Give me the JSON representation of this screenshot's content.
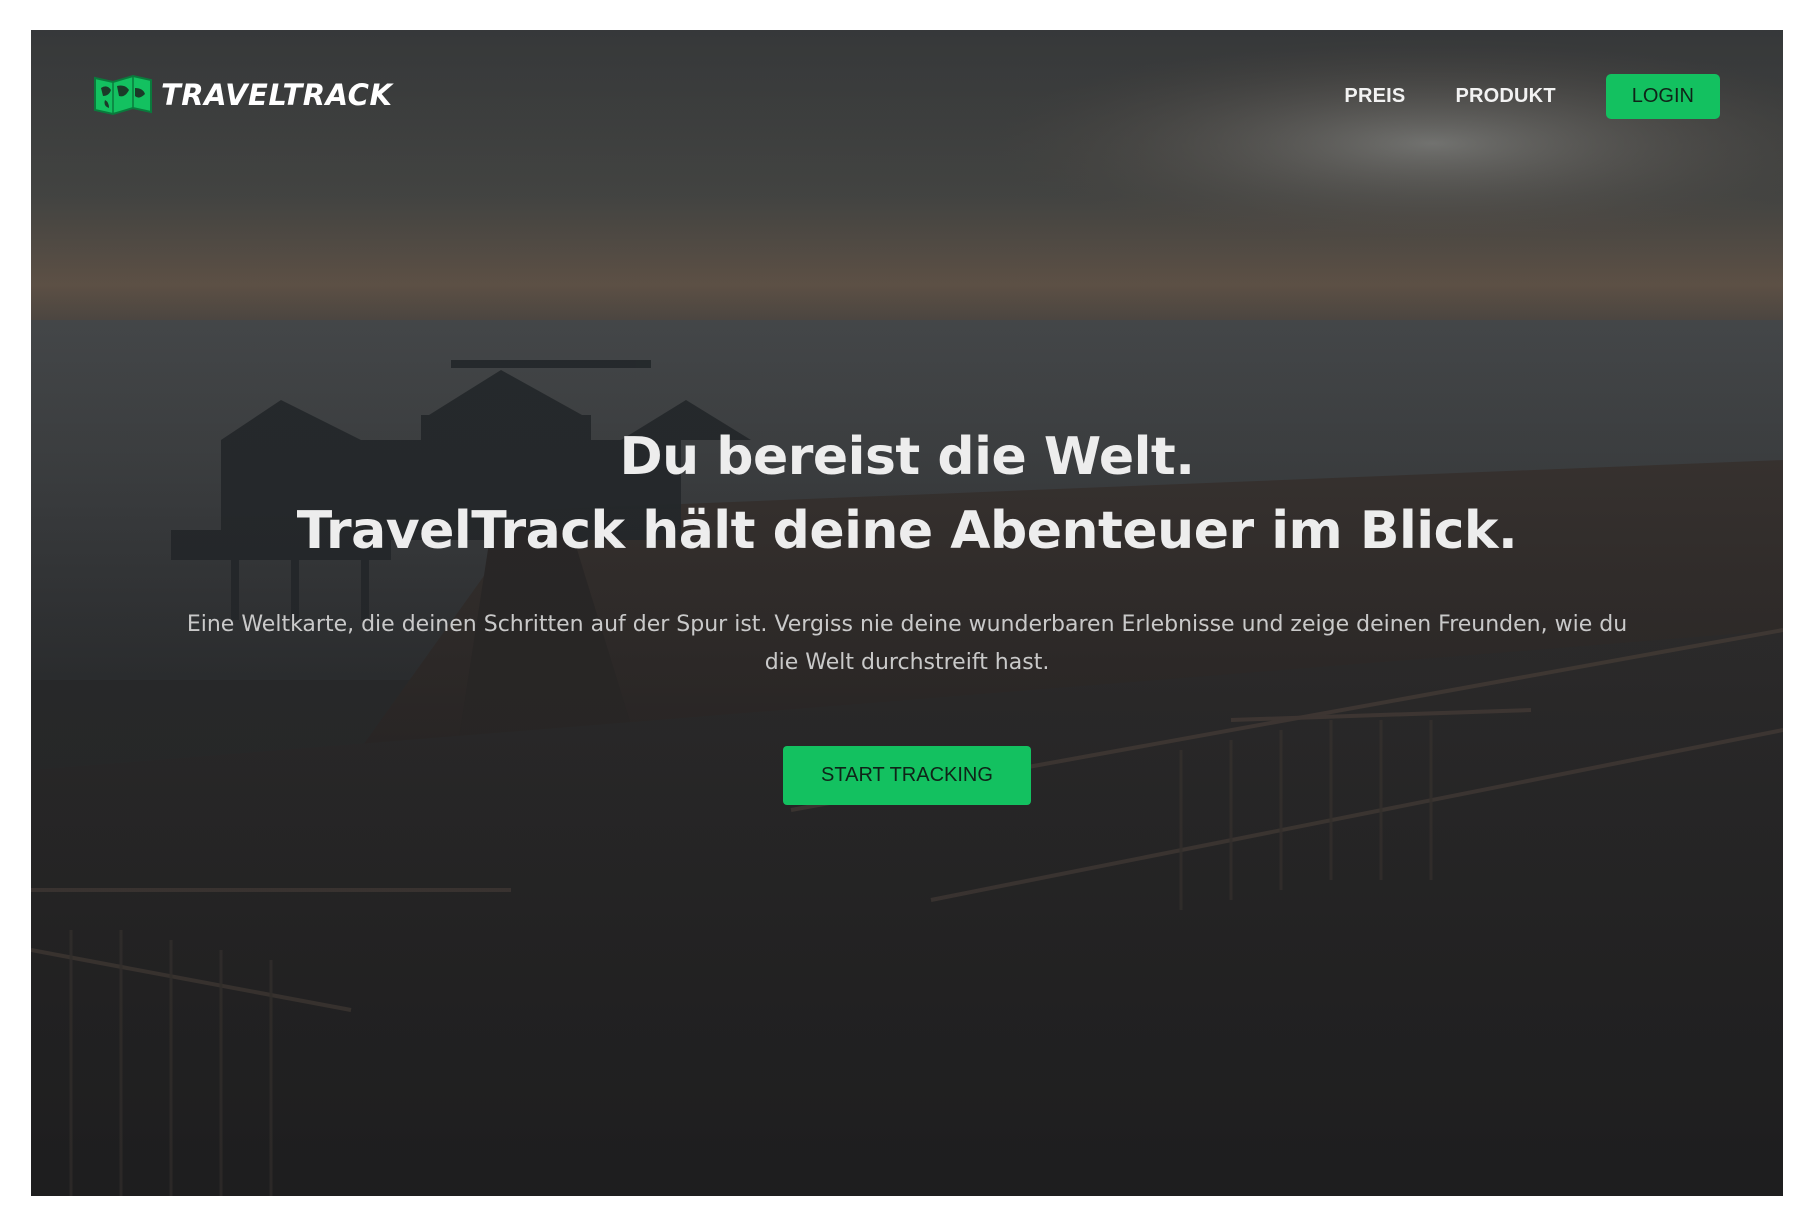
{
  "brand": {
    "name": "TRAVELTRACK",
    "icon": "world-map-icon",
    "accent": "#13c160"
  },
  "nav": {
    "items": [
      {
        "label": "PREIS"
      },
      {
        "label": "PRODUKT"
      }
    ],
    "login_label": "LOGIN"
  },
  "hero": {
    "headline_line1": "Du bereist die Welt.",
    "headline_line2": "TravelTrack hält deine Abenteuer im Blick.",
    "subline": "Eine Weltkarte, die deinen Schritten auf der Spur ist. Vergiss nie deine wunderbaren Erlebnisse und zeige deinen Freunden, wie du die Welt durchstreift hast.",
    "cta_label": "START TRACKING",
    "background": "pier-sunset-photo"
  }
}
